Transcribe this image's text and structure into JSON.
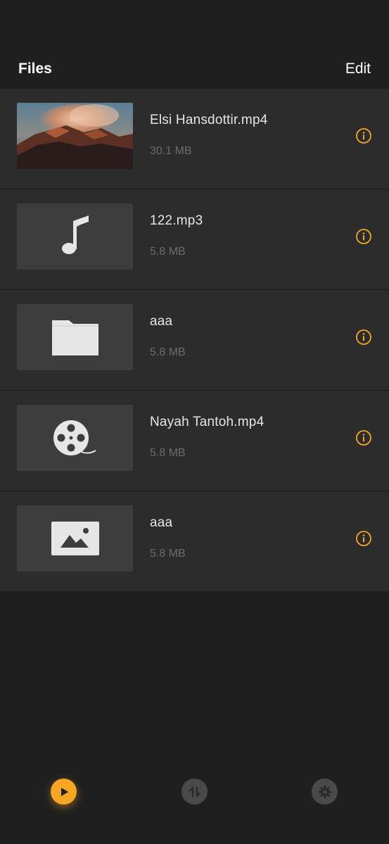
{
  "header": {
    "title": "Files",
    "edit_label": "Edit"
  },
  "files": [
    {
      "name": "Elsi Hansdottir.mp4",
      "size": "30.1 MB",
      "thumb": "mountain-photo"
    },
    {
      "name": "122.mp3",
      "size": "5.8 MB",
      "thumb": "music-note-icon"
    },
    {
      "name": "aaa",
      "size": "5.8 MB",
      "thumb": "folder-icon"
    },
    {
      "name": "Nayah Tantoh.mp4",
      "size": "5.8 MB",
      "thumb": "film-reel-icon"
    },
    {
      "name": "aaa",
      "size": "5.8 MB",
      "thumb": "image-icon"
    }
  ],
  "tabs": [
    {
      "icon": "play-icon",
      "active": true
    },
    {
      "icon": "transfer-icon",
      "active": false
    },
    {
      "icon": "gear-icon",
      "active": false
    }
  ],
  "colors": {
    "accent": "#f5a623",
    "row_background": "#2c2c2c",
    "page_background": "#1f1f1f",
    "secondary_text": "#6c6c6c"
  }
}
